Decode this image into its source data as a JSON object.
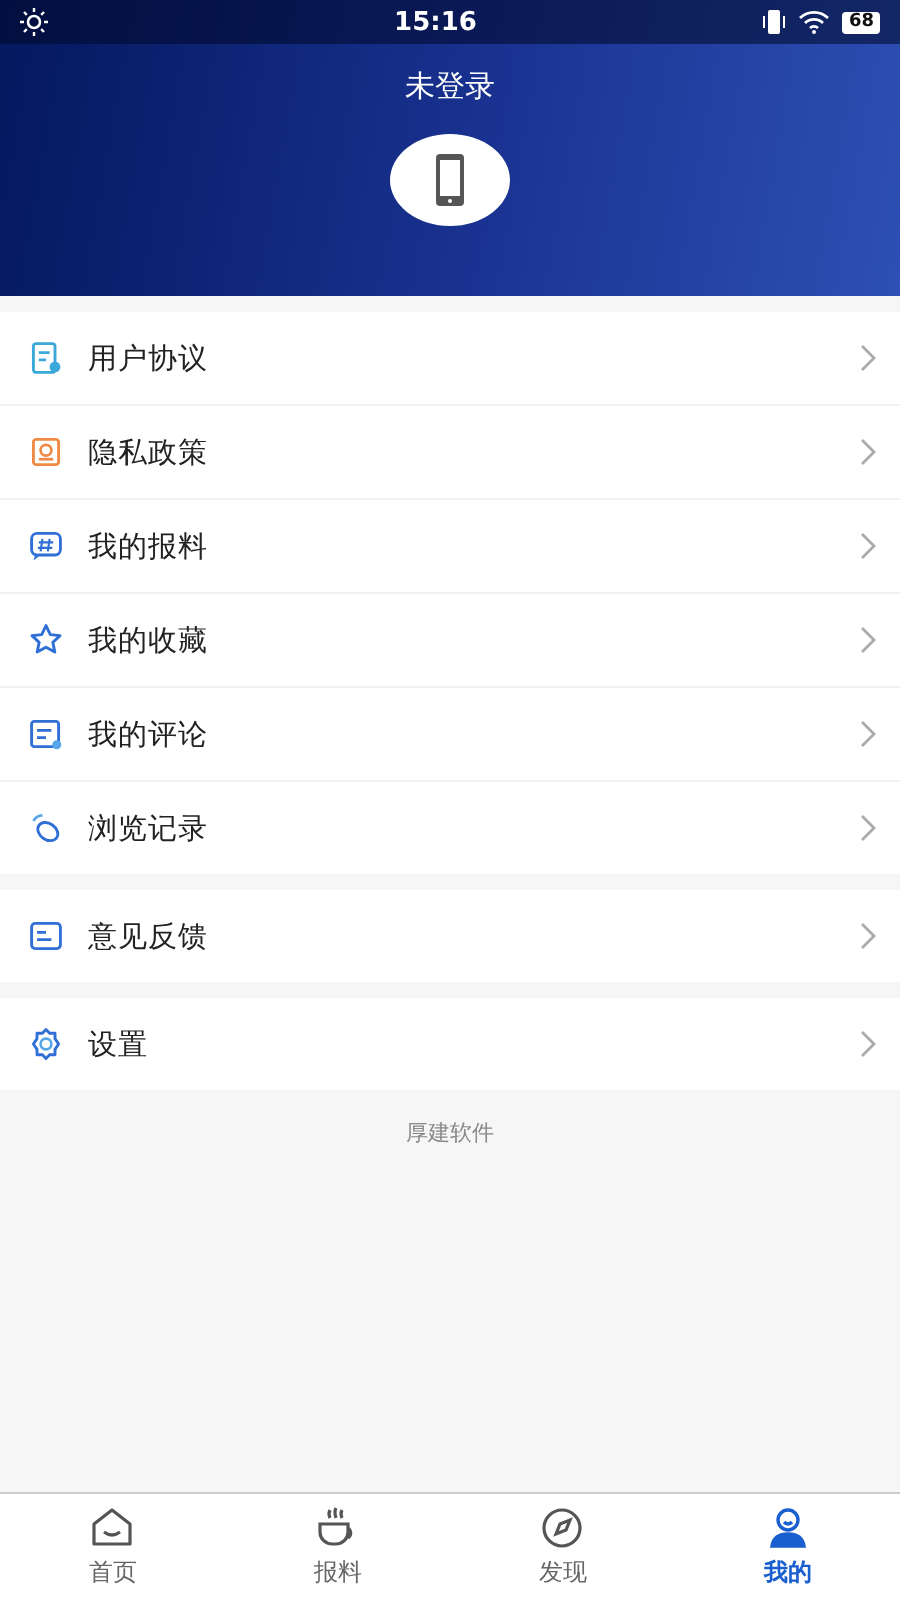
{
  "status_bar": {
    "time": "15:16",
    "battery": "68"
  },
  "header": {
    "title": "未登录"
  },
  "menu_groups": [
    {
      "items": [
        {
          "label": "用户协议"
        },
        {
          "label": "隐私政策"
        },
        {
          "label": "我的报料"
        },
        {
          "label": "我的收藏"
        },
        {
          "label": "我的评论"
        },
        {
          "label": "浏览记录"
        }
      ]
    },
    {
      "items": [
        {
          "label": "意见反馈"
        }
      ]
    },
    {
      "items": [
        {
          "label": "设置"
        }
      ]
    }
  ],
  "footer": "厚建软件",
  "tabs": [
    {
      "label": "首页",
      "selected": false
    },
    {
      "label": "报料",
      "selected": false
    },
    {
      "label": "发现",
      "selected": false
    },
    {
      "label": "我的",
      "selected": true
    }
  ]
}
